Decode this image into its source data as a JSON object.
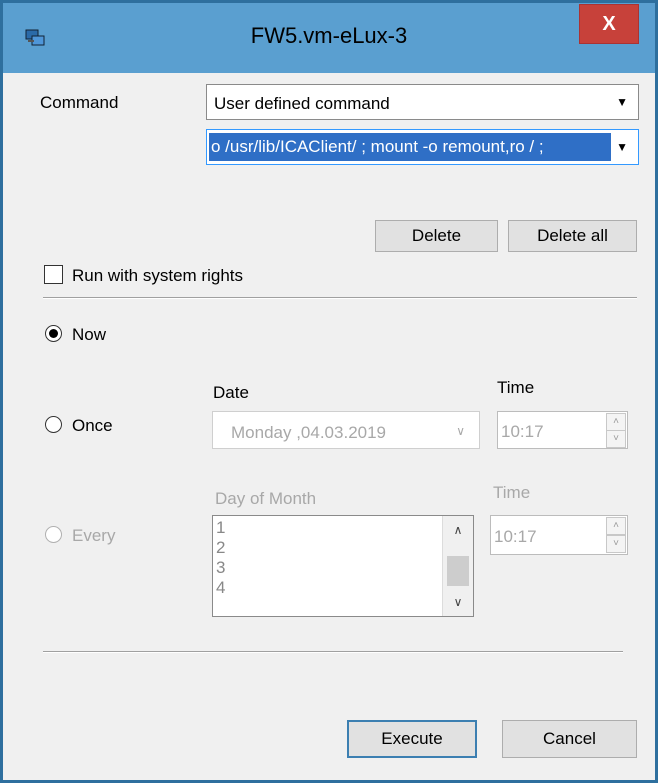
{
  "window": {
    "title": "FW5.vm-eLux-3",
    "close_glyph": "X",
    "accent": "#5a9fd0"
  },
  "command": {
    "label": "Command",
    "selected": "User defined command",
    "edit_value": "o /usr/lib/ICAClient/ ; mount -o remount,ro / ;"
  },
  "buttons": {
    "delete": "Delete",
    "delete_all": "Delete all",
    "execute": "Execute",
    "cancel": "Cancel"
  },
  "run_system_rights": "Run with system rights",
  "schedule": {
    "now": "Now",
    "once": "Once",
    "every": "Every",
    "date_label": "Date",
    "time_label": "Time",
    "date_value": "Monday   ,04.03.2019",
    "time_value": "10:17",
    "dom_label": "Day of Month",
    "time2_label": "Time",
    "time2_value": "10:17",
    "days": [
      "1",
      "2",
      "3",
      "4"
    ]
  }
}
